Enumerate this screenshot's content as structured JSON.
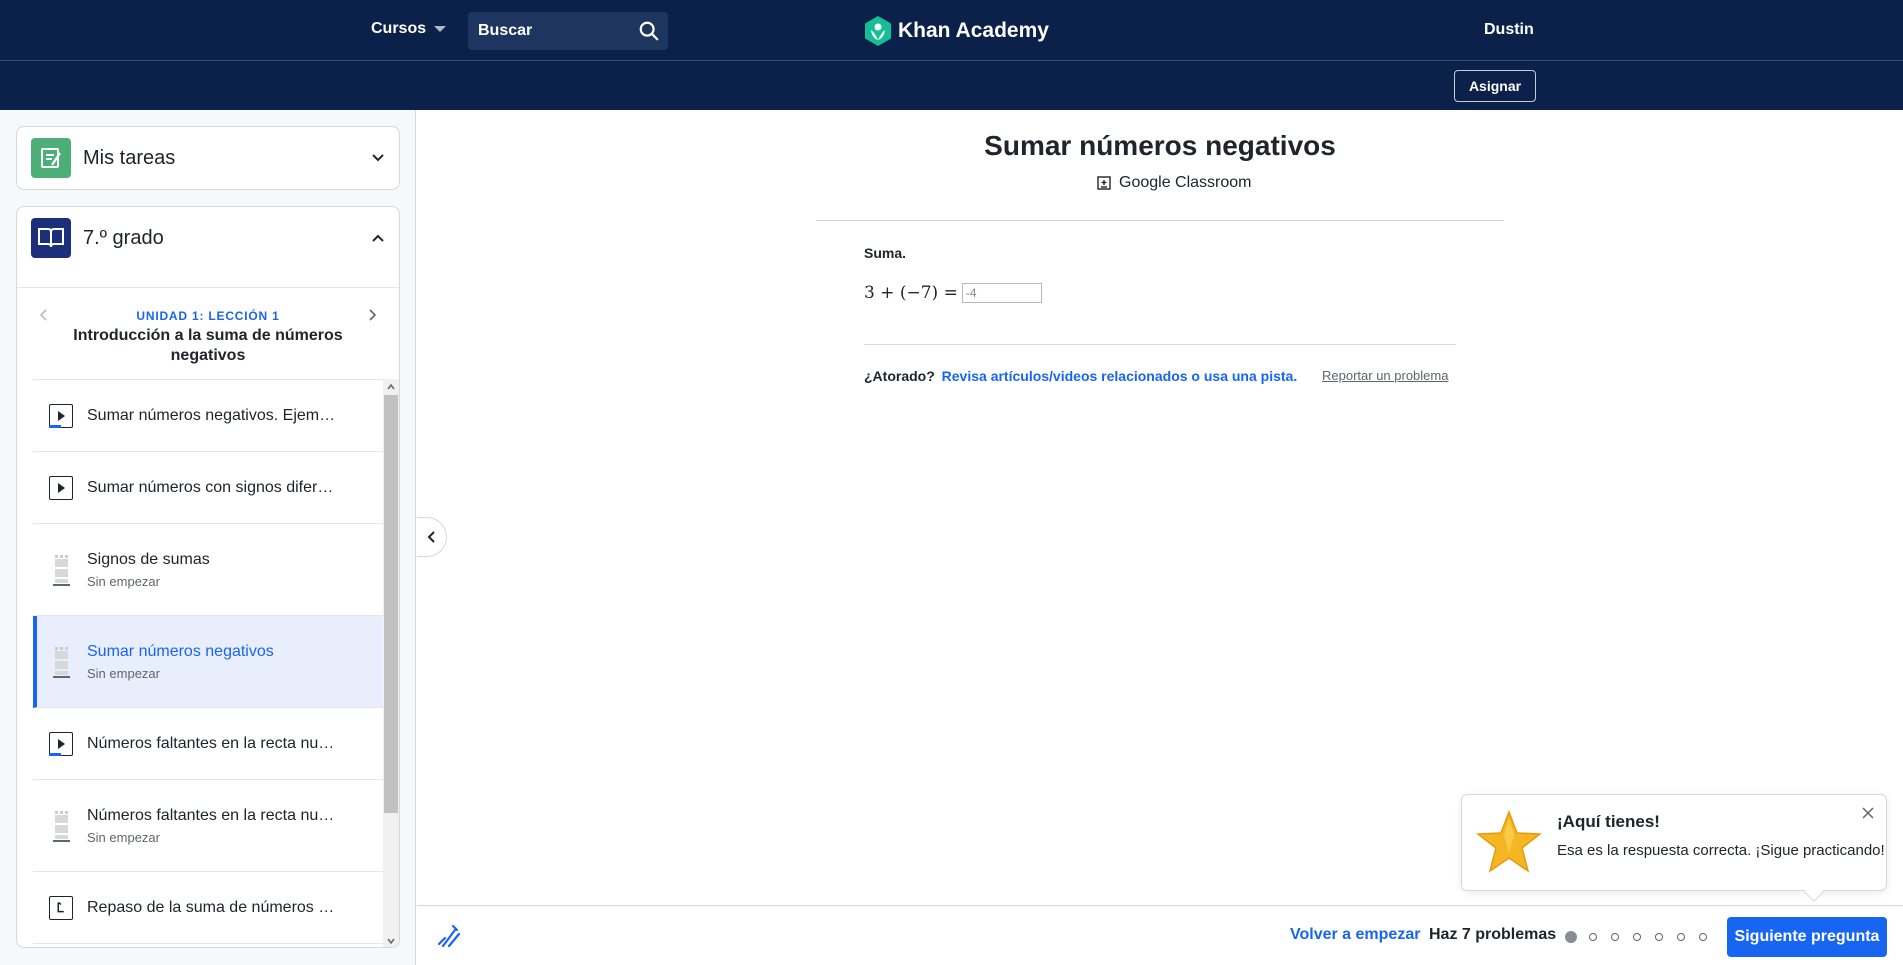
{
  "header": {
    "courses_label": "Cursos",
    "search_placeholder": "Buscar",
    "logo_text": "Khan Academy",
    "user_name": "Dustin",
    "assign_label": "Asignar"
  },
  "sidebar": {
    "my_tasks": "Mis tareas",
    "grade": "7.º grado",
    "lesson": {
      "unit": "UNIDAD 1: LECCIÓN 1",
      "title": "Introducción a la suma de números negativos"
    },
    "items": [
      {
        "type": "video",
        "label": "Sumar números negativos. Ejemplo",
        "status": ""
      },
      {
        "type": "video",
        "label": "Sumar números con signos diferentes",
        "status": ""
      },
      {
        "type": "practice",
        "label": "Signos de sumas",
        "status": "Sin empezar"
      },
      {
        "type": "practice",
        "label": "Sumar números negativos",
        "status": "Sin empezar",
        "active": true
      },
      {
        "type": "video",
        "label": "Números faltantes en la recta numérica",
        "status": ""
      },
      {
        "type": "practice",
        "label": "Números faltantes en la recta numérica",
        "status": "Sin empezar"
      },
      {
        "type": "article",
        "label": "Repaso de la suma de números negativos",
        "status": ""
      }
    ]
  },
  "exercise": {
    "title": "Sumar números negativos",
    "google_classroom": "Google Classroom",
    "question_label": "Suma.",
    "equation": "3 + (−7) =",
    "answer_value": "-4",
    "stuck_label": "¿Atorado?",
    "stuck_link": "Revisa artículos/videos relacionados o usa una pista.",
    "report_label": "Reportar un problema"
  },
  "toast": {
    "title": "¡Aquí tienes!",
    "message": "Esa es la respuesta correcta. ¡Sigue practicando!"
  },
  "footer": {
    "restart_label": "Volver a empezar",
    "count_label": "Haz 7 problemas",
    "completed_problems": 1,
    "total_problems": 7,
    "next_label": "Siguiente pregunta"
  },
  "colors": {
    "header_bg": "#0b2149",
    "accent_blue": "#1865f2",
    "star_gold": "#f5b623"
  }
}
